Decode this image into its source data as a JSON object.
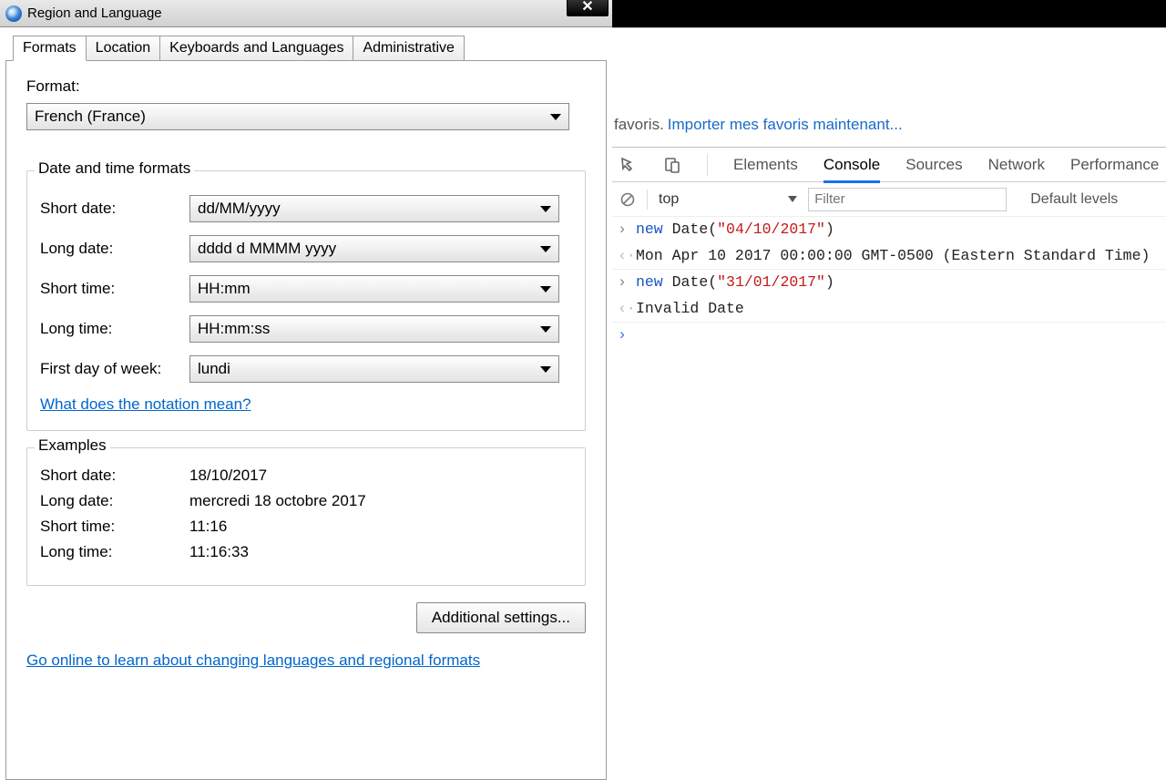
{
  "dialog": {
    "title": "Region and Language",
    "tabs": [
      "Formats",
      "Location",
      "Keyboards and Languages",
      "Administrative"
    ],
    "activeTab": 0,
    "formatLabel": "Format:",
    "formatValue": "French (France)",
    "groupTitle": "Date and time formats",
    "rows": {
      "shortDate": {
        "label": "Short date:",
        "value": "dd/MM/yyyy"
      },
      "longDate": {
        "label": "Long date:",
        "value": "dddd d MMMM yyyy"
      },
      "shortTime": {
        "label": "Short time:",
        "value": "HH:mm"
      },
      "longTime": {
        "label": "Long time:",
        "value": "HH:mm:ss"
      },
      "firstDay": {
        "label": "First day of week:",
        "value": "lundi"
      }
    },
    "notationLink": "What does the notation mean?",
    "examplesTitle": "Examples",
    "examples": {
      "shortDate": {
        "label": "Short date:",
        "value": "18/10/2017"
      },
      "longDate": {
        "label": "Long date:",
        "value": "mercredi 18 octobre 2017"
      },
      "shortTime": {
        "label": "Short time:",
        "value": "11:16"
      },
      "longTime": {
        "label": "Long time:",
        "value": "11:16:33"
      }
    },
    "additionalBtn": "Additional settings...",
    "onlineLink": "Go online to learn about changing languages and regional formats"
  },
  "browser": {
    "bookbarText": "favoris.",
    "bookbarLink": "Importer mes favoris maintenant..."
  },
  "devtools": {
    "tabs": [
      "Elements",
      "Console",
      "Sources",
      "Network",
      "Performance"
    ],
    "activeTab": 1,
    "contextLabel": "top",
    "filterPlaceholder": "Filter",
    "levelsLabel": "Default levels"
  },
  "console": {
    "lines": [
      {
        "type": "in",
        "seg": [
          {
            "cls": "c-kw",
            "t": "new"
          },
          {
            "cls": "c-plain",
            "t": " Date("
          },
          {
            "cls": "c-str",
            "t": "\"04/10/2017\""
          },
          {
            "cls": "c-plain",
            "t": ")"
          }
        ]
      },
      {
        "type": "out",
        "text": "Mon Apr 10 2017 00:00:00 GMT-0500 (Eastern Standard Time)"
      },
      {
        "type": "in",
        "seg": [
          {
            "cls": "c-kw",
            "t": "new"
          },
          {
            "cls": "c-plain",
            "t": " Date("
          },
          {
            "cls": "c-str",
            "t": "\"31/01/2017\""
          },
          {
            "cls": "c-plain",
            "t": ")"
          }
        ]
      },
      {
        "type": "out",
        "text": "Invalid Date"
      }
    ]
  }
}
